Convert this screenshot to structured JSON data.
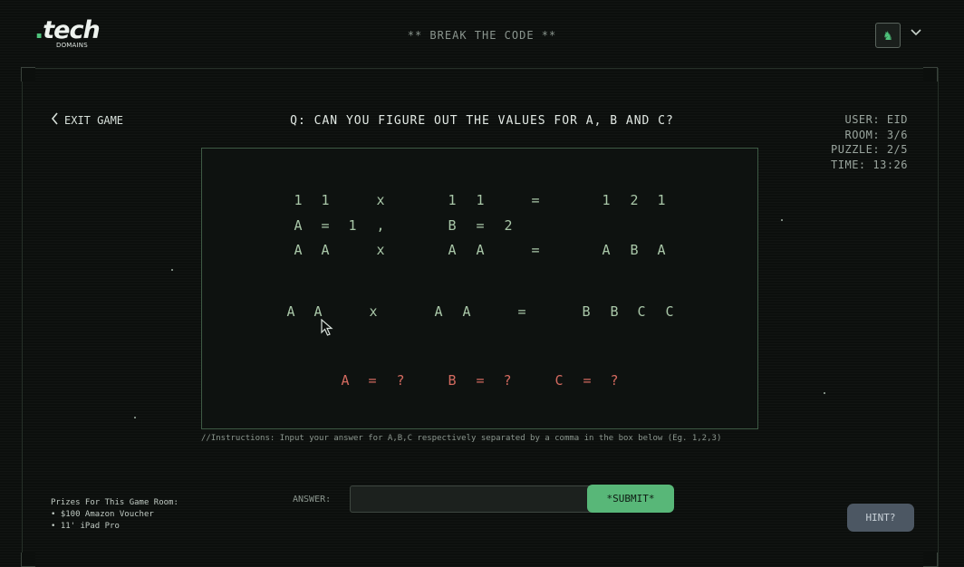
{
  "header": {
    "logo_main": "tech",
    "logo_dot": ".",
    "logo_sub": "DOMAINS",
    "title": "** BREAK THE CODE **",
    "avatar_icon": "chess-knight-icon",
    "menu_icon": "chevron-down-icon"
  },
  "exit": {
    "label": "EXIT GAME"
  },
  "question": "Q: CAN YOU FIGURE OUT THE VALUES FOR A, B AND C?",
  "stats": {
    "user": "USER: EID",
    "room": "ROOM: 3/6",
    "puzzle": "PUZZLE: 2/5",
    "time": "TIME: 13:26"
  },
  "puzzle": {
    "row1": [
      "1",
      "1",
      "x",
      "1",
      "1",
      "=",
      "1",
      "2",
      "1"
    ],
    "row2": [
      "A",
      "=",
      "1",
      ",",
      "B",
      "=",
      "2"
    ],
    "row3": [
      "A",
      "A",
      "x",
      "A",
      "A",
      "=",
      "A",
      "B",
      "A"
    ],
    "row4": [
      "A",
      "A",
      "x",
      "A",
      "A",
      "=",
      "B",
      "B",
      "C",
      "C"
    ],
    "unknowns": [
      "A",
      "=",
      "?",
      "B",
      "=",
      "?",
      "C",
      "=",
      "?"
    ]
  },
  "instructions": "//Instructions: Input your answer for A,B,C respectively separated by a comma in the box below (Eg. 1,2,3)",
  "answer": {
    "label": "ANSWER:",
    "value": "",
    "placeholder": ""
  },
  "submit_label": "*SUBMIT*",
  "hint_label": "HINT?",
  "prizes": {
    "title": "Prizes For This Game Room:",
    "items": [
      "$100 Amazon Voucher",
      "11' iPad Pro"
    ]
  },
  "colors": {
    "accent": "#58b778",
    "unknown": "#d36a5f",
    "hint": "#4c5763"
  }
}
